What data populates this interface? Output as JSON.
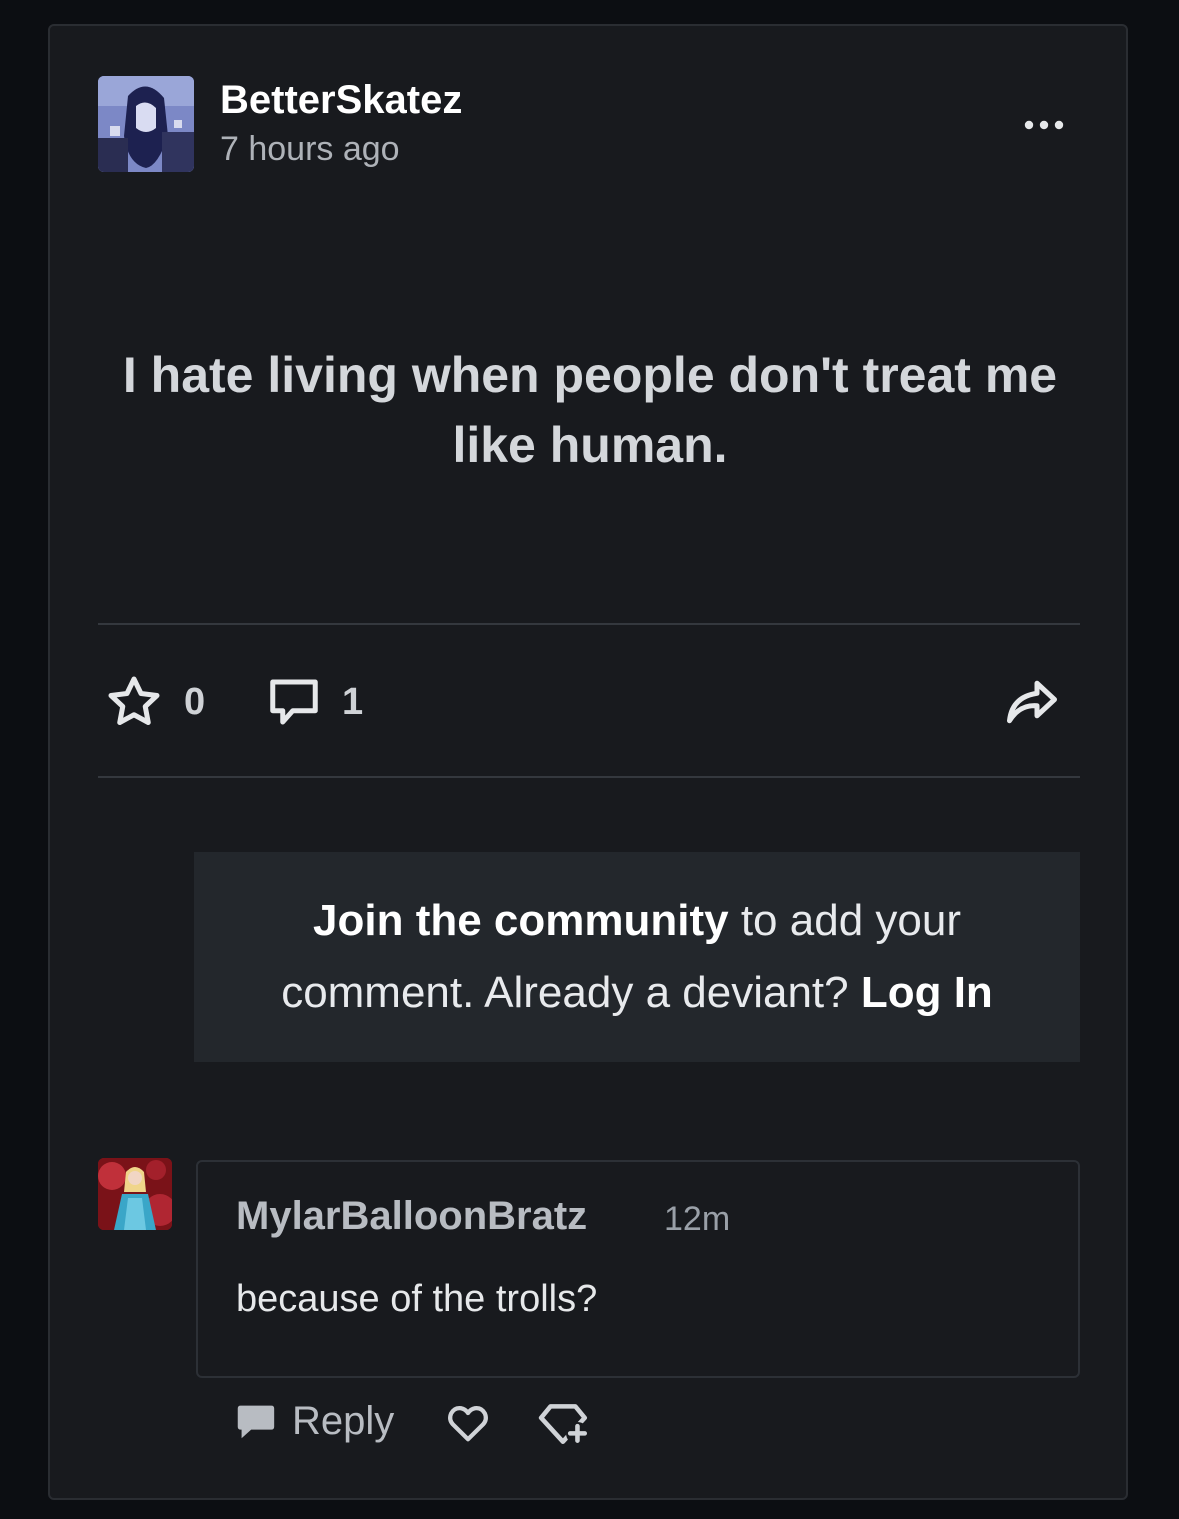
{
  "post": {
    "author": "BetterSkatez",
    "time_ago": "7 hours ago",
    "text": "I hate living when people don't treat me like human.",
    "favorites_count": "0",
    "comments_count": "1"
  },
  "join_prompt": {
    "bold_lead": "Join the community",
    "middle": " to add your comment. Already a deviant? ",
    "login": "Log In"
  },
  "comment": {
    "author": "MylarBalloonBratz",
    "time": "12m",
    "text": "because of the trolls?",
    "reply_label": "Reply"
  },
  "icons": {
    "more": "more-dots-icon",
    "favorite": "star-icon",
    "comment": "comment-bubble-icon",
    "share": "share-arrow-icon",
    "reply": "reply-bubble-icon",
    "like": "heart-icon",
    "award": "badge-plus-icon"
  },
  "colors": {
    "page_background": "#0c0e12",
    "card_background": "#181a1e",
    "join_box_background": "#23272c"
  }
}
